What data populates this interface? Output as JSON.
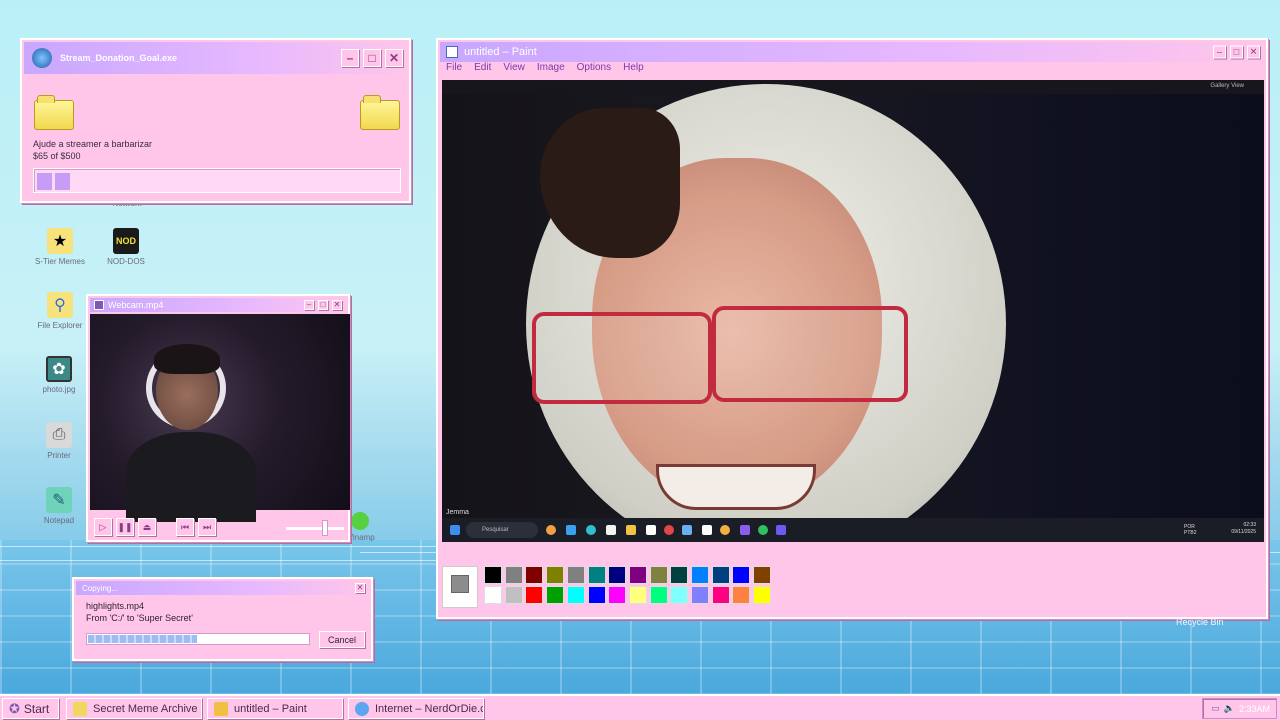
{
  "donation": {
    "title": "Stream_Donation_Goal.exe",
    "message": "Ajude a streamer a barbarizar",
    "progress_text": "$65 of $500",
    "progress": 0.13
  },
  "desktop_icons": [
    {
      "label": "S-Tier Memes"
    },
    {
      "label": "NOD-DOS"
    },
    {
      "label": "File Explorer"
    },
    {
      "label": "photo.jpg"
    },
    {
      "label": "Printer"
    },
    {
      "label": "Notepad"
    },
    {
      "label": "Winamp"
    },
    {
      "label": "Network"
    }
  ],
  "webcam": {
    "title": "Webcam.mp4"
  },
  "copying": {
    "title": "Copying...",
    "filename": "highlights.mp4",
    "path": "From 'C:/' to 'Super Secret'",
    "cancel_label": "Cancel",
    "progress": 0.49
  },
  "paint": {
    "title": "untitled – Paint",
    "menu": [
      "File",
      "Edit",
      "View",
      "Image",
      "Options",
      "Help"
    ],
    "gallery_label": "Gallery View",
    "speaker_name": "Jemma",
    "search_placeholder": "Pesquisar",
    "clock_time": "02:33",
    "clock_date": "09/11/2025",
    "lang": "POR PTB2"
  },
  "palette": {
    "current": "#8c8c8c",
    "top": [
      "#000000",
      "#808080",
      "#800000",
      "#808000",
      "#808080",
      "#008080",
      "#000080",
      "#800080",
      "#808040",
      "#004040",
      "#0080ff",
      "#004080",
      "#0000ff",
      "#804000"
    ],
    "bottom": [
      "#ffffff",
      "#c0c0c0",
      "#ff0000",
      "#00a000",
      "#00ffff",
      "#0000ff",
      "#ff00ff",
      "#ffff80",
      "#00ff80",
      "#80ffff",
      "#8080ff",
      "#ff0080",
      "#ff8040",
      "#ffff00"
    ]
  },
  "recycle_label": "Recycle Bin",
  "taskbar": {
    "start_label": "Start",
    "items": [
      {
        "label": "Secret Meme Archive"
      },
      {
        "label": "untitled – Paint"
      },
      {
        "label": "Internet – NerdOrDie.com"
      }
    ],
    "clock": "2:33AM"
  }
}
